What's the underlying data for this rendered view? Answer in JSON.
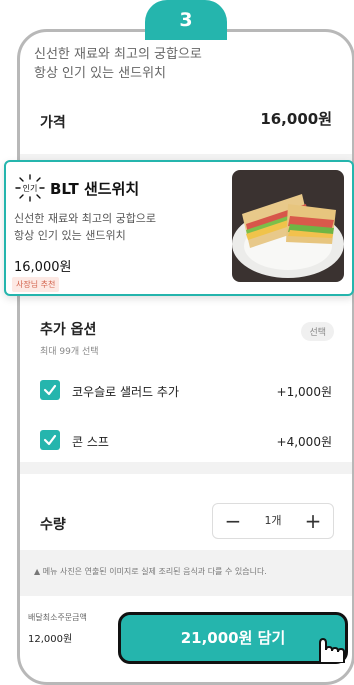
{
  "step": {
    "number": "3"
  },
  "top_item": {
    "description_line1": "신선한 재료와 최고의 궁합으로",
    "description_line2": "항상 인기 있는 샌드위치"
  },
  "price_row": {
    "label": "가격",
    "value": "16,000원"
  },
  "product_card": {
    "popular_label": "인기",
    "title": "BLT 샌드위치",
    "description_line1": "신선한 재료와 최고의 궁합으로",
    "description_line2": "항상 인기 있는 샌드위치",
    "price": "16,000원",
    "badge": "사장님 추천",
    "image_icon": "sandwich-photo"
  },
  "options": {
    "title": "추가 옵션",
    "subtitle": "최대 99개 선택",
    "badge": "선택",
    "items": [
      {
        "label": "코우슬로 샐러드 추가",
        "price": "+1,000원",
        "checked": true
      },
      {
        "label": "콘 스프",
        "price": "+4,000원",
        "checked": true
      }
    ]
  },
  "quantity": {
    "label": "수량",
    "minus": "−",
    "value": "1개",
    "plus": "+"
  },
  "notice": {
    "icon": "warning-icon",
    "text": "메뉴 사진은 연출된 이미지로 실제 조리된 음식과 다를 수 있습니다."
  },
  "min_order": {
    "label": "배달최소주문금액",
    "value": "12,000원"
  },
  "cta": {
    "label": "21,000원 담기"
  },
  "colors": {
    "accent": "#25b5ad",
    "badge_bg": "#fde9e4",
    "badge_text": "#d2634c"
  }
}
